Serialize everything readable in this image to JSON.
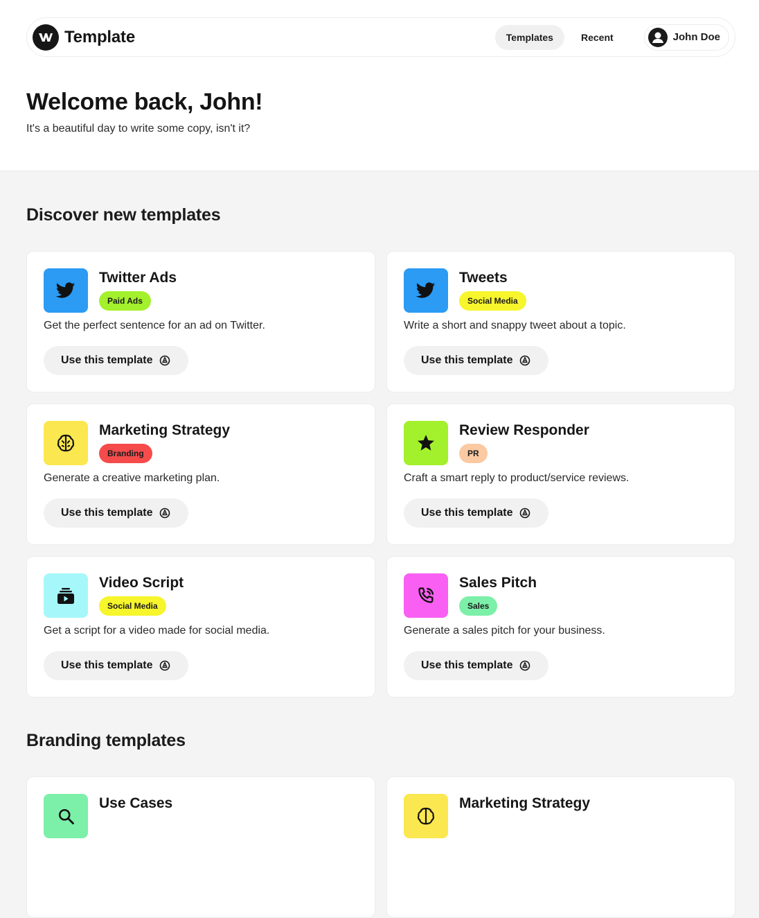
{
  "header": {
    "brand": "Template",
    "tabs": [
      {
        "label": "Templates",
        "active": true
      },
      {
        "label": "Recent",
        "active": false
      }
    ],
    "user_name": "John Doe"
  },
  "welcome": {
    "title": "Welcome back, John!",
    "subtitle": "It's a beautiful day to write some copy, isn't it?"
  },
  "sections": {
    "discover_title": "Discover new templates",
    "branding_title": "Branding templates"
  },
  "button_label": "Use this template",
  "cards": [
    {
      "title": "Twitter Ads",
      "badge": "Paid Ads",
      "badge_color": "#a3f02c",
      "icon": "twitter-icon",
      "icon_bg": "#2b9bf4",
      "desc": "Get the perfect sentence for an ad on Twitter."
    },
    {
      "title": "Tweets",
      "badge": "Social Media",
      "badge_color": "#f7f52c",
      "icon": "twitter-icon",
      "icon_bg": "#2b9bf4",
      "desc": "Write a short and snappy tweet about a topic."
    },
    {
      "title": "Marketing Strategy",
      "badge": "Branding",
      "badge_color": "#f54b4b",
      "icon": "brain-icon",
      "icon_bg": "#fbe74f",
      "desc": "Generate a creative marketing plan."
    },
    {
      "title": "Review Responder",
      "badge": "PR",
      "badge_color": "#fbc9a2",
      "icon": "star-icon",
      "icon_bg": "#a3f02c",
      "desc": "Craft a smart reply to product/service reviews."
    },
    {
      "title": "Video Script",
      "badge": "Social Media",
      "badge_color": "#f7f52c",
      "icon": "video-stack-icon",
      "icon_bg": "#a6f7f9",
      "desc": "Get a script for a video made for social media."
    },
    {
      "title": "Sales Pitch",
      "badge": "Sales",
      "badge_color": "#7cf0a8",
      "icon": "phone-call-icon",
      "icon_bg": "#f95ff2",
      "desc": "Generate a sales pitch for your business."
    }
  ],
  "branding_cards": [
    {
      "title": "Use Cases",
      "icon": "search-icon",
      "icon_bg": "#7cf0a8"
    },
    {
      "title": "Marketing Strategy",
      "icon": "brain-icon",
      "icon_bg": "#fbe74f"
    }
  ],
  "colors": {
    "page_bg": "#f4f4f4",
    "card_bg": "#ffffff",
    "button_bg": "#f1f1f1",
    "text": "#1a1a1a"
  }
}
